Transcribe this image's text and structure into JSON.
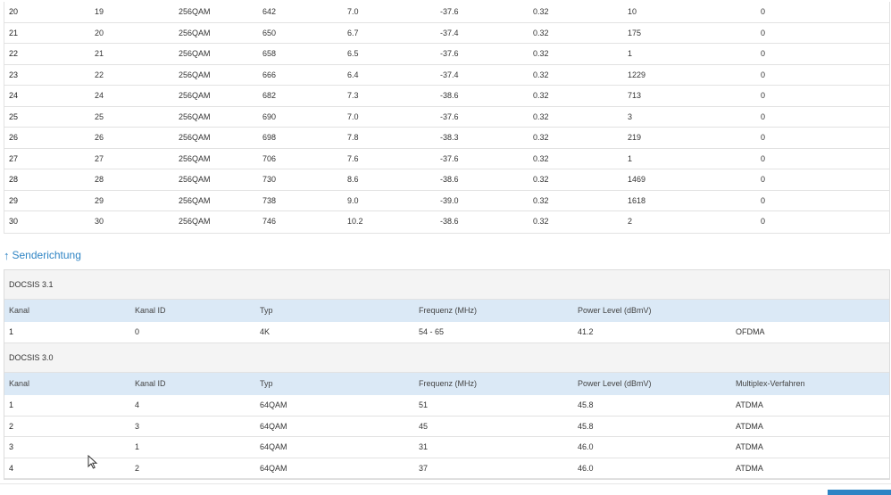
{
  "downstream": {
    "rows": [
      [
        "20",
        "19",
        "256QAM",
        "642",
        "7.0",
        "-37.6",
        "0.32",
        "10",
        "0"
      ],
      [
        "21",
        "20",
        "256QAM",
        "650",
        "6.7",
        "-37.4",
        "0.32",
        "175",
        "0"
      ],
      [
        "22",
        "21",
        "256QAM",
        "658",
        "6.5",
        "-37.6",
        "0.32",
        "1",
        "0"
      ],
      [
        "23",
        "22",
        "256QAM",
        "666",
        "6.4",
        "-37.4",
        "0.32",
        "1229",
        "0"
      ],
      [
        "24",
        "24",
        "256QAM",
        "682",
        "7.3",
        "-38.6",
        "0.32",
        "713",
        "0"
      ],
      [
        "25",
        "25",
        "256QAM",
        "690",
        "7.0",
        "-37.6",
        "0.32",
        "3",
        "0"
      ],
      [
        "26",
        "26",
        "256QAM",
        "698",
        "7.8",
        "-38.3",
        "0.32",
        "219",
        "0"
      ],
      [
        "27",
        "27",
        "256QAM",
        "706",
        "7.6",
        "-37.6",
        "0.32",
        "1",
        "0"
      ],
      [
        "28",
        "28",
        "256QAM",
        "730",
        "8.6",
        "-38.6",
        "0.32",
        "1469",
        "0"
      ],
      [
        "29",
        "29",
        "256QAM",
        "738",
        "9.0",
        "-39.0",
        "0.32",
        "1618",
        "0"
      ],
      [
        "30",
        "30",
        "256QAM",
        "746",
        "10.2",
        "-38.6",
        "0.32",
        "2",
        "0"
      ]
    ]
  },
  "upstream": {
    "link_label": "Senderichtung",
    "groups": [
      {
        "title": "DOCSIS 3.1",
        "headers": [
          "Kanal",
          "Kanal ID",
          "Typ",
          "Frequenz (MHz)",
          "Power Level (dBmV)",
          ""
        ],
        "rows": [
          [
            "1",
            "0",
            "4K",
            "54 - 65",
            "41.2",
            "OFDMA"
          ]
        ]
      },
      {
        "title": "DOCSIS 3.0",
        "headers": [
          "Kanal",
          "Kanal ID",
          "Typ",
          "Frequenz (MHz)",
          "Power Level (dBmV)",
          "Multiplex-Verfahren"
        ],
        "rows": [
          [
            "1",
            "4",
            "64QAM",
            "51",
            "45.8",
            "ATDMA"
          ],
          [
            "2",
            "3",
            "64QAM",
            "45",
            "45.8",
            "ATDMA"
          ],
          [
            "3",
            "1",
            "64QAM",
            "31",
            "46.0",
            "ATDMA"
          ],
          [
            "4",
            "2",
            "64QAM",
            "37",
            "46.0",
            "ATDMA"
          ]
        ]
      }
    ]
  },
  "colors": {
    "accent": "#2e84c4",
    "header_bg": "#dbe9f6",
    "group_bg": "#f4f4f4",
    "border": "#e2e2e2"
  },
  "icons": {
    "section_link": "arrow-up-icon",
    "pointer": "cursor-icon"
  }
}
